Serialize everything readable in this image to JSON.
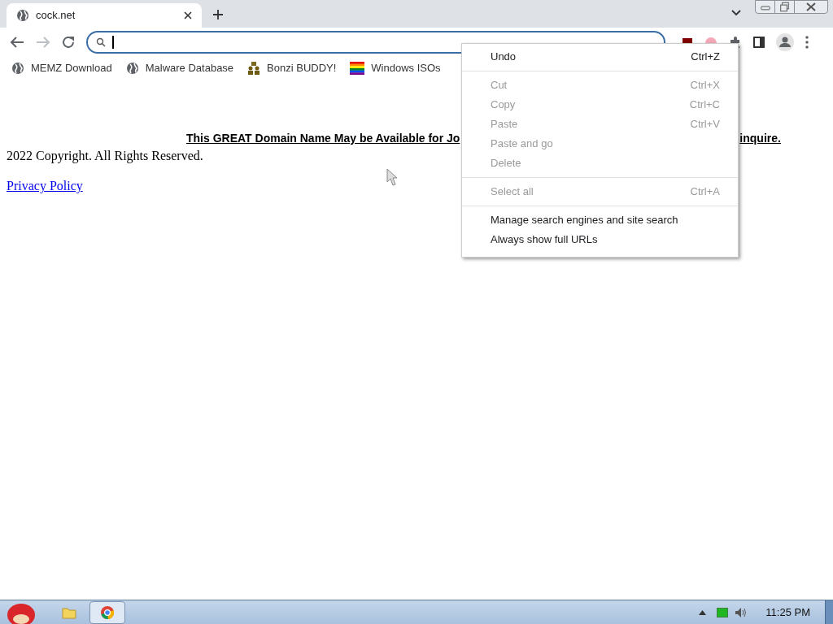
{
  "tab": {
    "title": "cock.net",
    "selected": true
  },
  "bookmarks": [
    {
      "label": "MEMZ Download",
      "kind": "globe"
    },
    {
      "label": "Malware Database",
      "kind": "globe"
    },
    {
      "label": "Bonzi BUDDY!",
      "kind": "people"
    },
    {
      "label": "Windows ISOs",
      "kind": "rainbow"
    }
  ],
  "page": {
    "heading_left": "This GREAT Domain Name May be Available for Jo",
    "heading_right": "inquire.",
    "copyright": "2022 Copyright. All Rights Reserved.",
    "link": "Privacy Policy"
  },
  "context_menu": {
    "groups": [
      [
        {
          "label": "Undo",
          "shortcut": "Ctrl+Z",
          "disabled": false
        }
      ],
      [
        {
          "label": "Cut",
          "shortcut": "Ctrl+X",
          "disabled": true
        },
        {
          "label": "Copy",
          "shortcut": "Ctrl+C",
          "disabled": true
        },
        {
          "label": "Paste",
          "shortcut": "Ctrl+V",
          "disabled": true
        },
        {
          "label": "Paste and go",
          "disabled": true
        },
        {
          "label": "Delete",
          "disabled": true
        }
      ],
      [
        {
          "label": "Select all",
          "shortcut": "Ctrl+A",
          "disabled": true
        }
      ],
      [
        {
          "label": "Manage search engines and site search",
          "disabled": false
        },
        {
          "label": "Always show full URLs",
          "disabled": false
        }
      ]
    ]
  },
  "taskbar": {
    "clock": "11:25 PM"
  }
}
